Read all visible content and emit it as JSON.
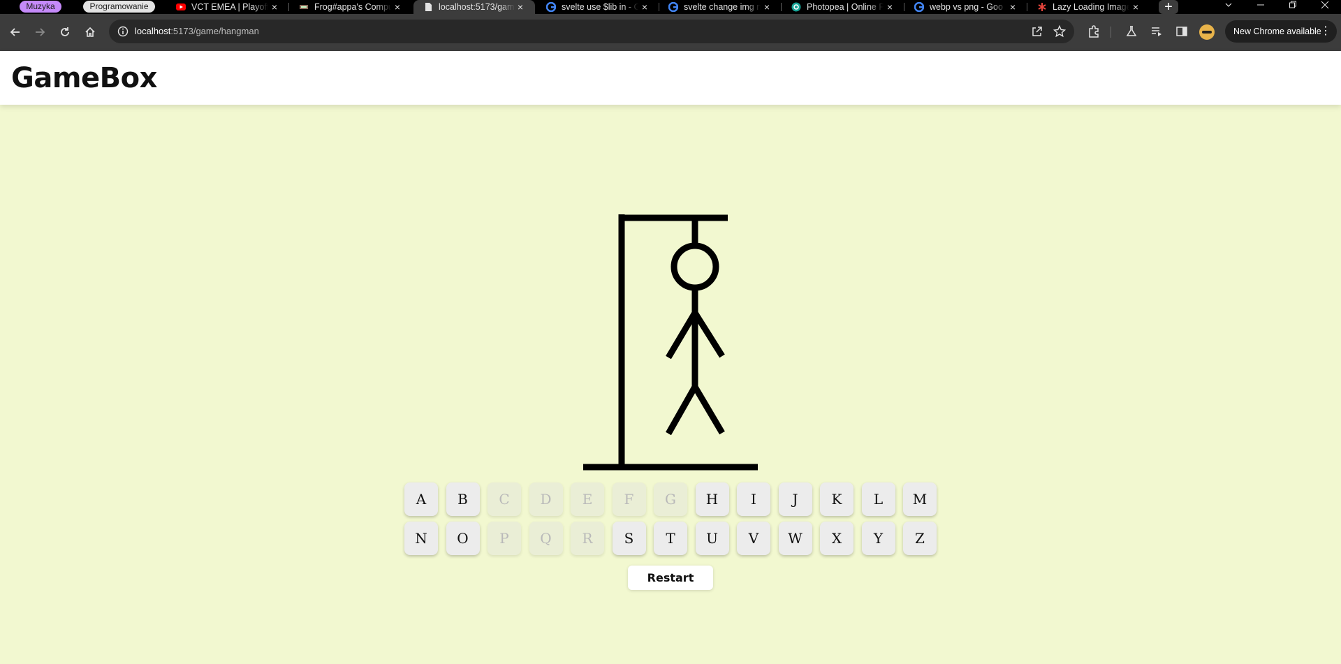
{
  "browser": {
    "tab_groups": [
      {
        "label": "Muzyka",
        "color": "#c58af9"
      },
      {
        "label": "Programowanie",
        "color": "#e3e3e3"
      }
    ],
    "tabs": [
      {
        "title": "VCT EMEA | Playoffs",
        "icon": "youtube-icon",
        "active": false
      },
      {
        "title": "Frog#appa's Compu",
        "icon": "site-icon",
        "active": false
      },
      {
        "title": "localhost:5173/gam",
        "icon": "page-icon",
        "active": true
      },
      {
        "title": "svelte use $lib in - G",
        "icon": "google-icon",
        "active": false
      },
      {
        "title": "svelte change img n",
        "icon": "google-icon",
        "active": false
      },
      {
        "title": "Photopea | Online P",
        "icon": "photopea-icon",
        "active": false
      },
      {
        "title": "webp vs png - Goo",
        "icon": "google-icon",
        "active": false
      },
      {
        "title": "Lazy Loading Image",
        "icon": "asterisk-icon",
        "active": false
      }
    ],
    "url_host": "localhost",
    "url_path": ":5173/game/hangman",
    "update_label": "New Chrome available"
  },
  "site": {
    "brand": "GameBox"
  },
  "game": {
    "wrong_guesses": 6,
    "letters": [
      {
        "letter": "A",
        "used": false
      },
      {
        "letter": "B",
        "used": false
      },
      {
        "letter": "C",
        "used": true
      },
      {
        "letter": "D",
        "used": true
      },
      {
        "letter": "E",
        "used": true
      },
      {
        "letter": "F",
        "used": true
      },
      {
        "letter": "G",
        "used": true
      },
      {
        "letter": "H",
        "used": false
      },
      {
        "letter": "I",
        "used": false
      },
      {
        "letter": "J",
        "used": false
      },
      {
        "letter": "K",
        "used": false
      },
      {
        "letter": "L",
        "used": false
      },
      {
        "letter": "M",
        "used": false
      },
      {
        "letter": "N",
        "used": false
      },
      {
        "letter": "O",
        "used": false
      },
      {
        "letter": "P",
        "used": true
      },
      {
        "letter": "Q",
        "used": true
      },
      {
        "letter": "R",
        "used": true
      },
      {
        "letter": "S",
        "used": false
      },
      {
        "letter": "T",
        "used": false
      },
      {
        "letter": "U",
        "used": false
      },
      {
        "letter": "V",
        "used": false
      },
      {
        "letter": "W",
        "used": false
      },
      {
        "letter": "X",
        "used": false
      },
      {
        "letter": "Y",
        "used": false
      },
      {
        "letter": "Z",
        "used": false
      }
    ],
    "restart_label": "Restart"
  }
}
